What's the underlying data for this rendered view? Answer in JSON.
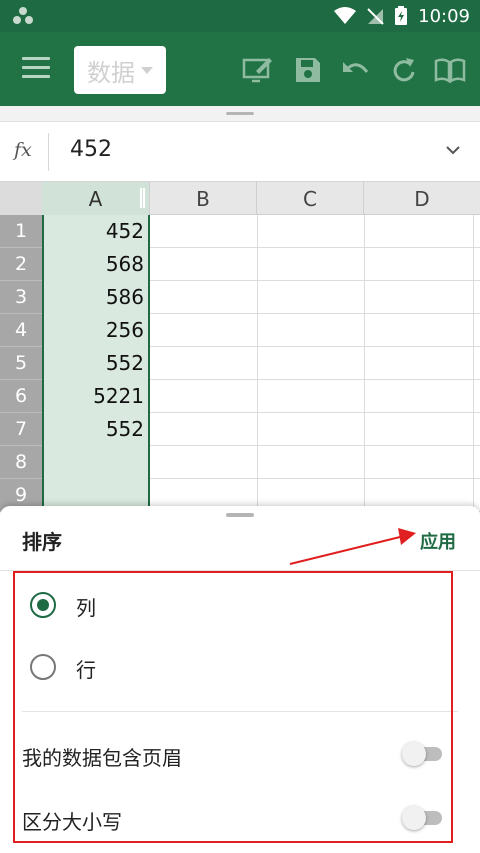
{
  "status_bar": {
    "time": "10:09"
  },
  "toolbar": {
    "view_dropdown_label": "数据",
    "icons": [
      "menu-icon",
      "draw-icon",
      "save-icon",
      "undo-icon",
      "redo-icon",
      "read-mode-icon"
    ]
  },
  "formula_bar": {
    "fx_label": "fx",
    "value": "452"
  },
  "grid": {
    "columns": [
      "A",
      "B",
      "C",
      "D"
    ],
    "rows": [
      {
        "num": "1",
        "a": "452"
      },
      {
        "num": "2",
        "a": "568"
      },
      {
        "num": "3",
        "a": "586"
      },
      {
        "num": "4",
        "a": "256"
      },
      {
        "num": "5",
        "a": "552"
      },
      {
        "num": "6",
        "a": "5221"
      },
      {
        "num": "7",
        "a": "552"
      },
      {
        "num": "8",
        "a": ""
      },
      {
        "num": "9",
        "a": ""
      }
    ]
  },
  "sort_sheet": {
    "title": "排序",
    "apply_label": "应用",
    "options": {
      "column_label": "列",
      "row_label": "行",
      "selected": "column"
    },
    "toggles": {
      "has_headers_label": "我的数据包含页眉",
      "has_headers_on": false,
      "case_sensitive_label": "区分大小写",
      "case_sensitive_on": false
    }
  },
  "colors": {
    "brand": "#217346",
    "status_bar": "#1e6b43",
    "selection": "#d9e9df",
    "annotation": "#e02020"
  }
}
